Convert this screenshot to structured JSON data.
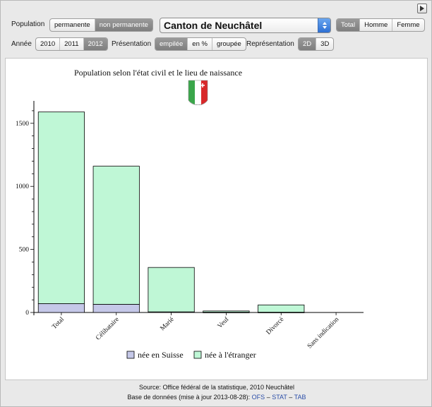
{
  "controls": {
    "population": {
      "label": "Population",
      "options": [
        "permanente",
        "non permanente"
      ],
      "selected": 1
    },
    "canton": {
      "value": "Canton de Neuchâtel"
    },
    "sex": {
      "options": [
        "Total",
        "Homme",
        "Femme"
      ],
      "selected": 0
    },
    "annee": {
      "label": "Année",
      "options": [
        "2010",
        "2011",
        "2012"
      ],
      "selected": 2
    },
    "presentation": {
      "label": "Présentation",
      "options": [
        "empilée",
        "en %",
        "groupée"
      ],
      "selected": 0
    },
    "representation": {
      "label": "Représentation",
      "options": [
        "2D",
        "3D"
      ],
      "selected": 0
    }
  },
  "icons": {
    "corner": "play-icon",
    "flag": "neuchatel-coat-of-arms-icon",
    "dropdown": "dropdown-arrows-icon"
  },
  "colors": {
    "suisse": "#c5c8e8",
    "etranger": "#bff7d6",
    "flag_green": "#3aa64a",
    "flag_white": "#ffffff",
    "flag_red": "#d8282a"
  },
  "chart_data": {
    "type": "bar",
    "stacked": true,
    "title": "Population selon l'état civil et le lieu de naissance",
    "categories": [
      "Total",
      "Célibataire",
      "Marié",
      "Veuf",
      "Divorcé",
      "Sans indication"
    ],
    "series": [
      {
        "name": "née en Suisse",
        "values": [
          70,
          65,
          5,
          2,
          2,
          0
        ]
      },
      {
        "name": "née à l'étranger",
        "values": [
          1520,
          1095,
          352,
          10,
          58,
          0
        ]
      }
    ],
    "ylim": [
      0,
      1650
    ],
    "yticks": [
      0,
      500,
      1000,
      1500
    ],
    "legend_position": "bottom"
  },
  "footer": {
    "source": "Source: Office fédéral de la statistique, 2010 Neuchâtel",
    "base": "Base de données (mise à jour 2013-08-28):",
    "links": [
      "OFS",
      "STAT",
      "TAB"
    ],
    "sep": "–"
  }
}
